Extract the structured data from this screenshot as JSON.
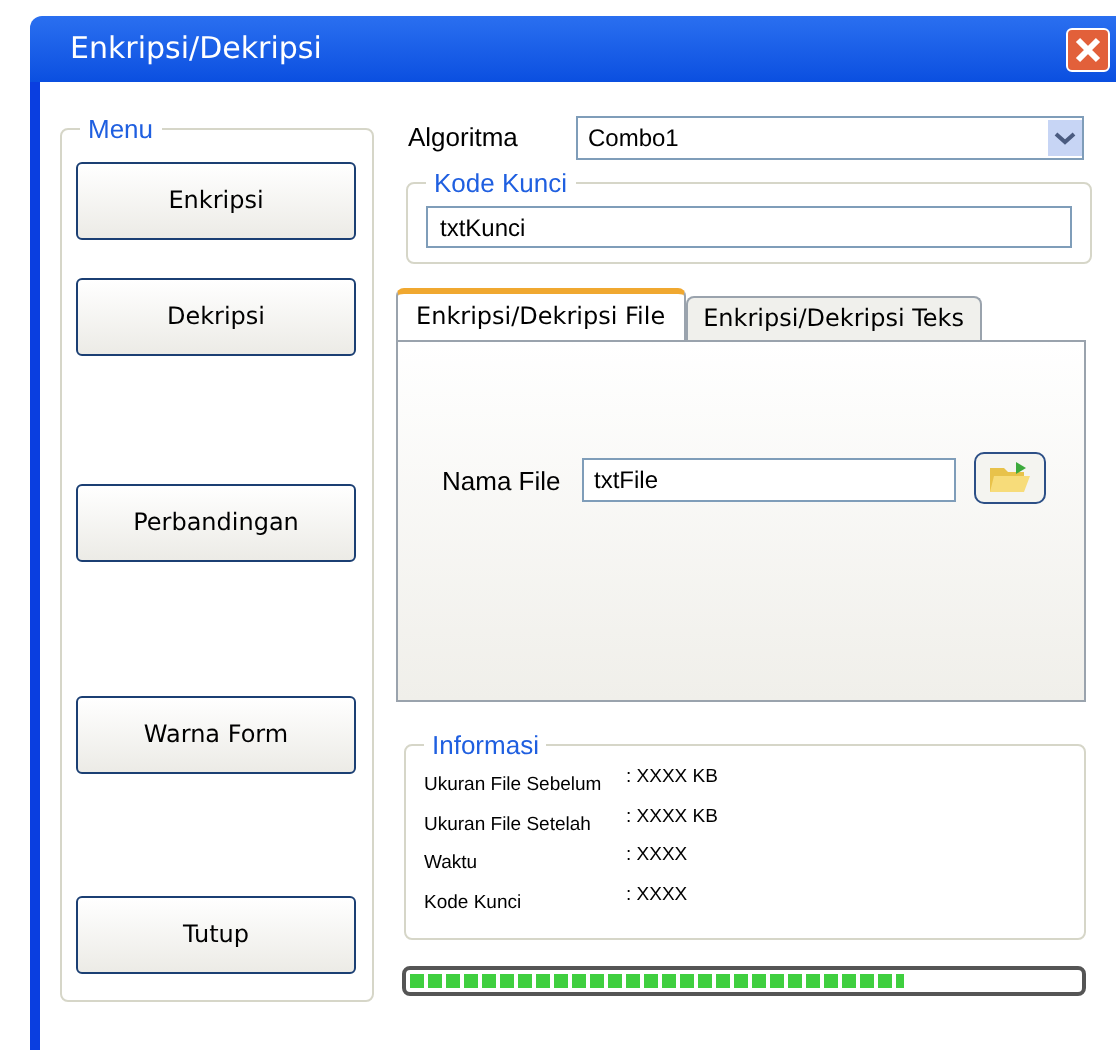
{
  "window": {
    "title": "Enkripsi/Dekripsi"
  },
  "menu": {
    "title": "Menu",
    "buttons": [
      "Enkripsi",
      "Dekripsi",
      "Perbandingan",
      "Warna Form",
      "Tutup"
    ]
  },
  "algoritma": {
    "label": "Algoritma",
    "value": "Combo1"
  },
  "kode_kunci": {
    "title": "Kode Kunci",
    "value": "txtKunci"
  },
  "tabs": [
    {
      "label": "Enkripsi/Dekripsi File",
      "selected": true
    },
    {
      "label": "Enkripsi/Dekripsi Teks",
      "selected": false
    }
  ],
  "file": {
    "label": "Nama File",
    "value": "txtFile"
  },
  "informasi": {
    "title": "Informasi",
    "rows": [
      {
        "label": "Ukuran File Sebelum",
        "value": ": XXXX KB"
      },
      {
        "label": "Ukuran File Setelah",
        "value": ": XXXX KB"
      },
      {
        "label": "Waktu",
        "value": ": XXXX"
      },
      {
        "label": "Kode Kunci",
        "value": ": XXXX"
      }
    ]
  },
  "progress": {
    "level": 0.74
  }
}
